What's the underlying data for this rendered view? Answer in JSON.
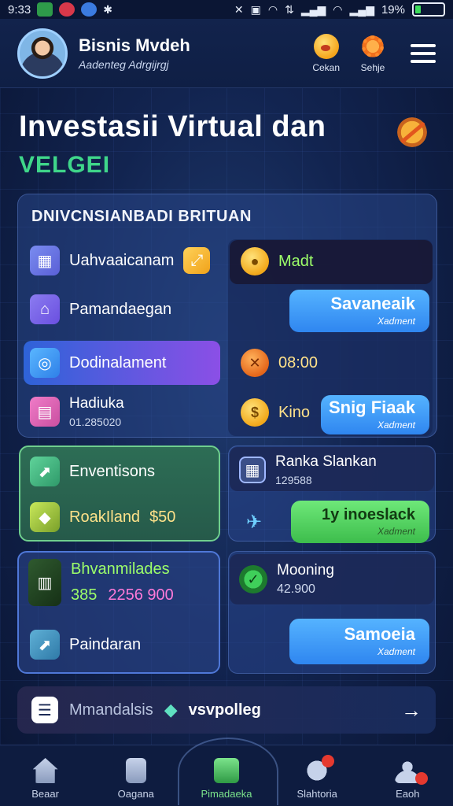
{
  "status_bar": {
    "time": "9:33",
    "battery": "19%"
  },
  "header": {
    "name": "Bisnis Mvdeh",
    "subtitle": "Aadenteg Adrgijrgj",
    "btn1_label": "Cekan",
    "btn2_label": "Sehje"
  },
  "title": {
    "main": "Investasii Virtual dan",
    "sub": "VELGEI"
  },
  "panel": {
    "heading": "DNIVCNSIANBADI BRITUAN",
    "left_items": [
      {
        "label": "Uahvaaicanam"
      },
      {
        "label": "Pamandaegan"
      },
      {
        "label": "Dodinalament"
      },
      {
        "label": "Hadiuka",
        "sub": "01.285020"
      }
    ],
    "right": {
      "top_label": "Madt",
      "button1": {
        "label": "Savaneaik",
        "sub": "Xadment"
      },
      "amount1": "08:00",
      "amount2": "Kino",
      "button2": {
        "label": "Snig Fiaak",
        "sub": "Xadment"
      }
    }
  },
  "cards": {
    "green": {
      "title": "Enventisons",
      "row_label": "RoakIland",
      "row_value": "$50"
    },
    "left2": {
      "title": "Bhvanmilades",
      "val1": "385",
      "val2": "2256 900",
      "item_label": "Paindaran"
    },
    "right1": {
      "title": "Ranka Slankan",
      "sub": "129588",
      "button": {
        "label": "1y inoeslack",
        "sub": "Xadment"
      }
    },
    "right2": {
      "title": "Mooning",
      "sub": "42.900",
      "button": {
        "label": "Samoeia",
        "sub": "Xadment"
      }
    }
  },
  "bottom_card": {
    "label": "Mmandalsis",
    "tag": "vsvpolleg"
  },
  "nav": [
    {
      "label": "Beaar"
    },
    {
      "label": "Oagana"
    },
    {
      "label": "Pimadaeka"
    },
    {
      "label": "Slahtoria"
    },
    {
      "label": "Eaoh"
    }
  ],
  "colors": {
    "accent_green": "#3fd68a",
    "accent_blue": "#2f86f0",
    "bg": "#122450"
  }
}
